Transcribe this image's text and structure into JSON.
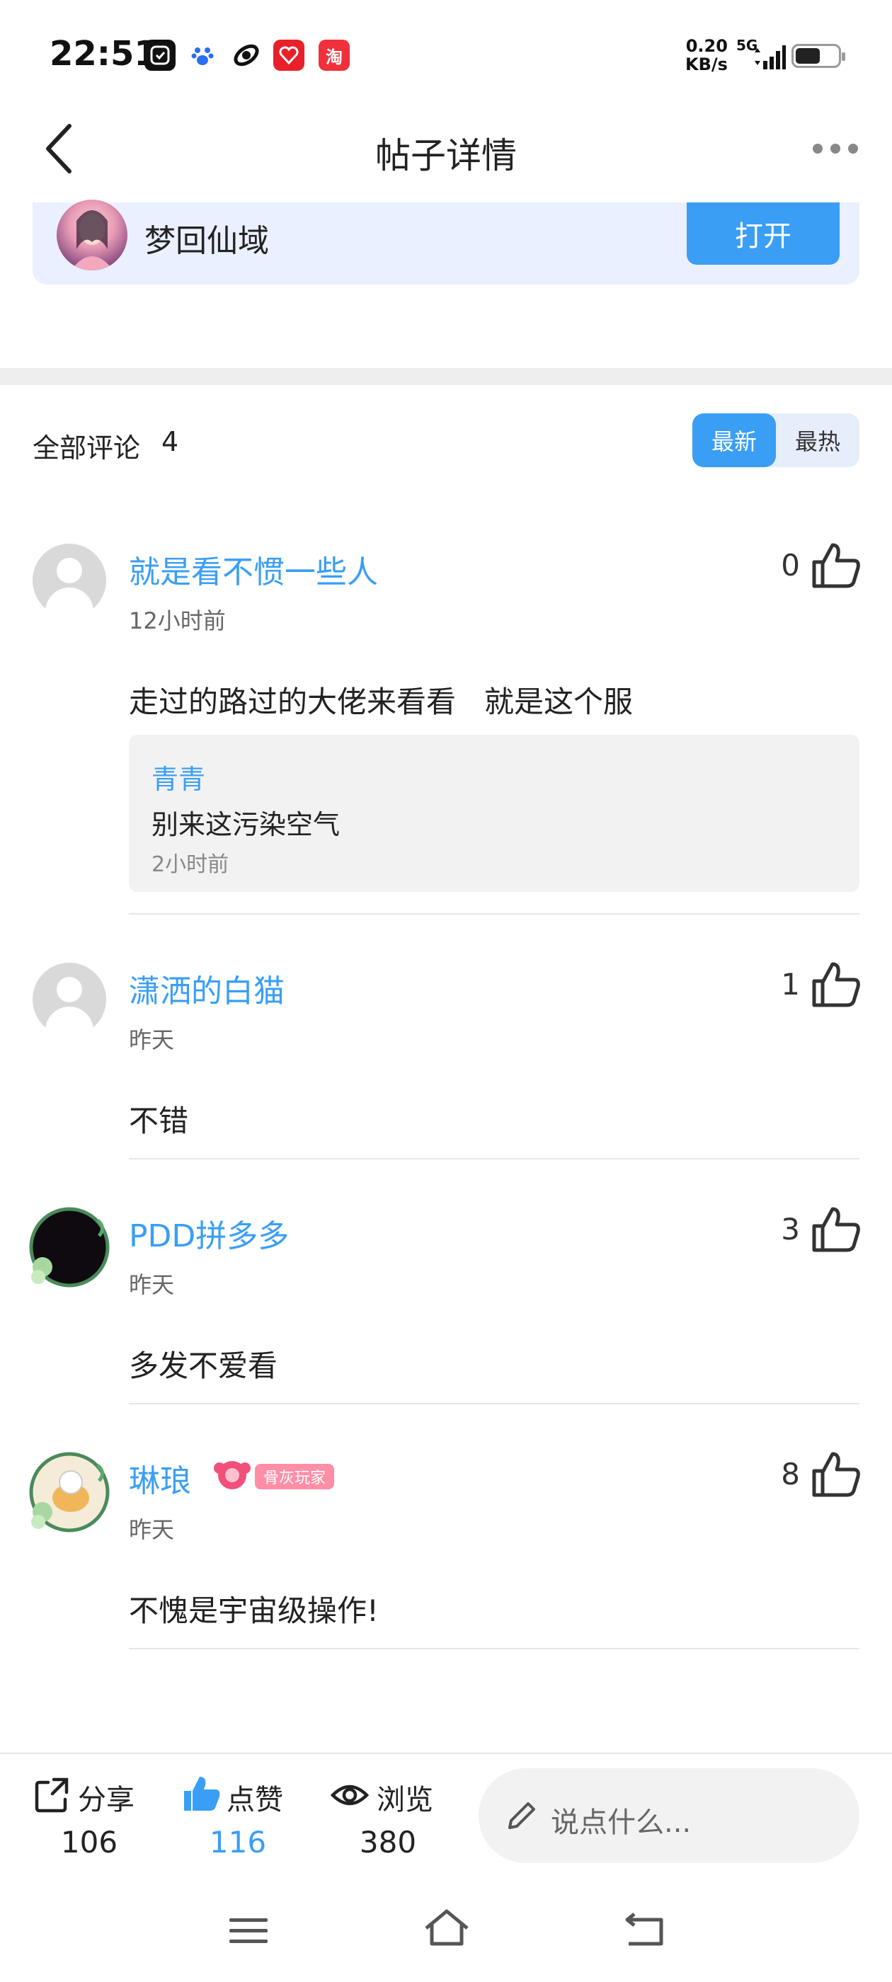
{
  "status_bar": {
    "time": "22:51",
    "net_speed_value": "0.20",
    "net_speed_unit": "KB/s",
    "network": "5G",
    "notification_icons": [
      "clock-app-icon",
      "baidu-icon",
      "browser-icon",
      "bank-app-icon",
      "taobao-icon"
    ]
  },
  "header": {
    "title": "帖子详情"
  },
  "game_card": {
    "name": "梦回仙域",
    "open_label": "打开"
  },
  "comments_header": {
    "label": "全部评论",
    "count": "4",
    "sort_newest": "最新",
    "sort_hot": "最热"
  },
  "comments": [
    {
      "username": "就是看不惯一些人",
      "time": "12小时前",
      "content": "走过的路过的大佬来看看   就是这个服",
      "likes": "0",
      "reply": {
        "username": "青青",
        "content": "别来这污染空气",
        "time": "2小时前"
      }
    },
    {
      "username": "潇洒的白猫",
      "time": "昨天",
      "content": "不错",
      "likes": "1"
    },
    {
      "username": "PDD拼多多",
      "time": "昨天",
      "content": "多发不爱看",
      "likes": "3"
    },
    {
      "username": "琳琅",
      "badge": "骨灰玩家",
      "time": "昨天",
      "content": "不愧是宇宙级操作!",
      "likes": "8"
    }
  ],
  "bottom_bar": {
    "share_label": "分享",
    "share_count": "106",
    "like_label": "点赞",
    "like_count": "116",
    "view_label": "浏览",
    "view_count": "380",
    "input_placeholder": "说点什么..."
  },
  "colors": {
    "accent": "#3a9ef5",
    "card_bg": "#eaf0ff",
    "badge": "#ff8ea6"
  }
}
